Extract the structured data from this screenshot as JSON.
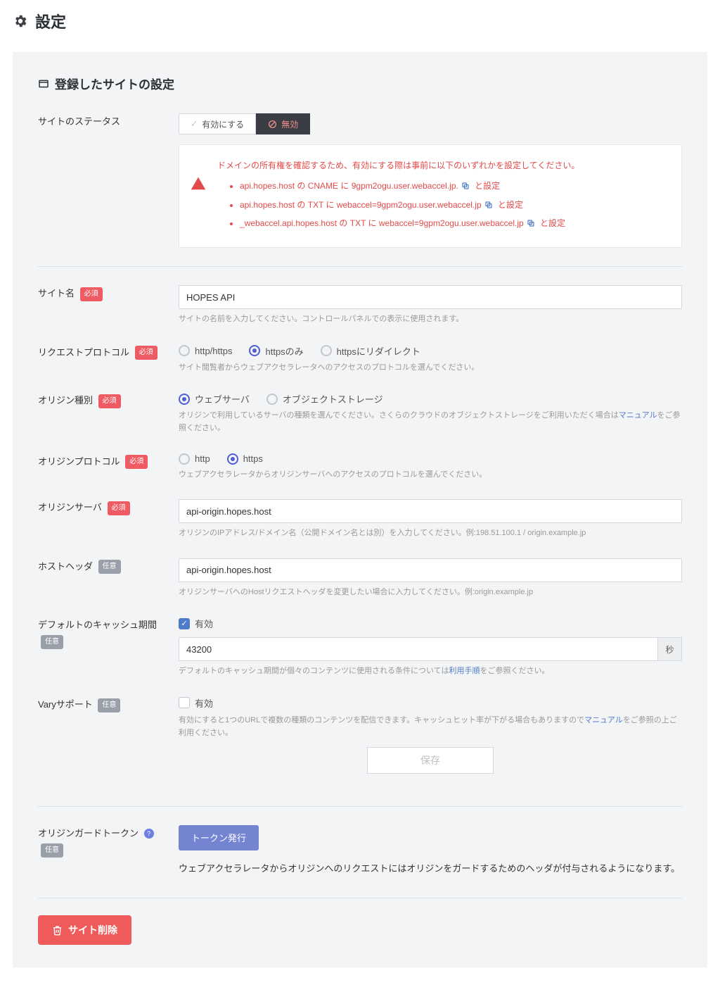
{
  "page": {
    "title": "設定"
  },
  "section": {
    "title": "登録したサイトの設定"
  },
  "status": {
    "label": "サイトのステータス",
    "enable": "有効にする",
    "disable": "無効"
  },
  "alert": {
    "intro": "ドメインの所有権を確認するため、有効にする際は事前に以下のいずれかを設定してください。",
    "items": [
      {
        "pre": "api.hopes.host の CNAME に ",
        "val": "9gpm2ogu.user.webaccel.jp.",
        "post": " と設定"
      },
      {
        "pre": "api.hopes.host の TXT に ",
        "val": "webaccel=9gpm2ogu.user.webaccel.jp",
        "post": " と設定"
      },
      {
        "pre": "_webaccel.api.hopes.host の TXT に ",
        "val": "webaccel=9gpm2ogu.user.webaccel.jp",
        "post": " と設定"
      }
    ]
  },
  "tags": {
    "required": "必須",
    "optional": "任意"
  },
  "site_name": {
    "label": "サイト名",
    "value": "HOPES API",
    "help": "サイトの名前を入力してください。コントロールパネルでの表示に使用されます。"
  },
  "req_protocol": {
    "label": "リクエストプロトコル",
    "options": [
      "http/https",
      "httpsのみ",
      "httpsにリダイレクト"
    ],
    "selected": 1,
    "help": "サイト閲覧者からウェブアクセラレータへのアクセスのプロトコルを選んでください。"
  },
  "origin_type": {
    "label": "オリジン種別",
    "options": [
      "ウェブサーバ",
      "オブジェクトストレージ"
    ],
    "selected": 0,
    "help_pre": "オリジンで利用しているサーバの種類を選んでください。さくらのクラウドのオブジェクトストレージをご利用いただく場合は",
    "help_link": "マニュアル",
    "help_post": "をご参照ください。"
  },
  "origin_protocol": {
    "label": "オリジンプロトコル",
    "options": [
      "http",
      "https"
    ],
    "selected": 1,
    "help": "ウェブアクセラレータからオリジンサーバへのアクセスのプロトコルを選んでください。"
  },
  "origin_server": {
    "label": "オリジンサーバ",
    "value": "api-origin.hopes.host",
    "help": "オリジンのIPアドレス/ドメイン名（公開ドメイン名とは別）を入力してください。例:198.51.100.1 / origin.example.jp"
  },
  "host_header": {
    "label": "ホストヘッダ",
    "value": "api-origin.hopes.host",
    "help": "オリジンサーバへのHostリクエストヘッダを変更したい場合に入力してください。例:origin.example.jp"
  },
  "cache": {
    "label": "デフォルトのキャッシュ期間",
    "check": "有効",
    "value": "43200",
    "unit": "秒",
    "help_pre": "デフォルトのキャッシュ期間が個々のコンテンツに使用される条件については",
    "help_link": "利用手順",
    "help_post": "をご参照ください。"
  },
  "vary": {
    "label": "Varyサポート",
    "check": "有効",
    "help_pre": "有効にすると1つのURLで複数の種類のコンテンツを配信できます。キャッシュヒット率が下がる場合もありますので",
    "help_link": "マニュアル",
    "help_post": "をご参照の上ご利用ください。"
  },
  "save": "保存",
  "token": {
    "label": "オリジンガードトークン",
    "button": "トークン発行",
    "desc": "ウェブアクセラレータからオリジンへのリクエストにはオリジンをガードするためのヘッダが付与されるようになります。"
  },
  "delete": "サイト削除"
}
